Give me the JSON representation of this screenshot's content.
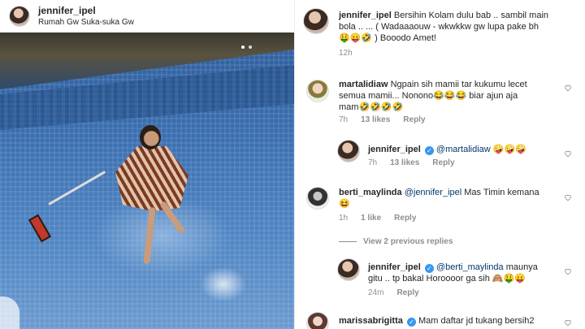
{
  "post": {
    "username": "jennifer_ipel",
    "location": "Rumah Gw Suka-suka Gw"
  },
  "comments": [
    {
      "username": "jennifer_ipel",
      "text_line1": "Bersihin Kolam dulu bab .. sambil main",
      "text_line2": "bola .. ... ( Wadaaaouw - wkwkkw gw lupa pake bh",
      "text_line3": "🤑😛🤣 ) Booodo Amet!",
      "time": "12h"
    },
    {
      "username": "martalidiaw",
      "text_line1": "Ngpain sih mamii tar kukumu lecet",
      "text_line2": "semua mamii... Nonono😂😂😂 biar ajun aja",
      "text_line3": "mam🤣🤣🤣🤣",
      "time": "7h",
      "likes": "13 likes",
      "reply": "Reply"
    },
    {
      "username": "jennifer_ipel",
      "mention": "@martalidiaw",
      "text": "🤪🤪🤪",
      "time": "7h",
      "likes": "13 likes",
      "reply": "Reply"
    },
    {
      "username": "berti_maylinda",
      "mention": "@jennifer_ipel",
      "text_line1": "Mas Timin kemana",
      "text_line2": "😆",
      "time": "1h",
      "likes": "1 like",
      "reply": "Reply"
    },
    {
      "username": "jennifer_ipel",
      "mention": "@berti_maylinda",
      "text_line1": "maunya",
      "text_line2": "gitu .. tp bakal Horoooor ga sih 🙈🤑😛",
      "time": "24m",
      "reply": "Reply"
    },
    {
      "username": "marissabrigitta",
      "text_line1": "Mam daftar jd tukang bersih2"
    }
  ],
  "view_previous": "View 2 previous replies",
  "colors": {
    "mention": "#00376b",
    "verified": "#3897f0",
    "muted": "#8e8e8e"
  }
}
